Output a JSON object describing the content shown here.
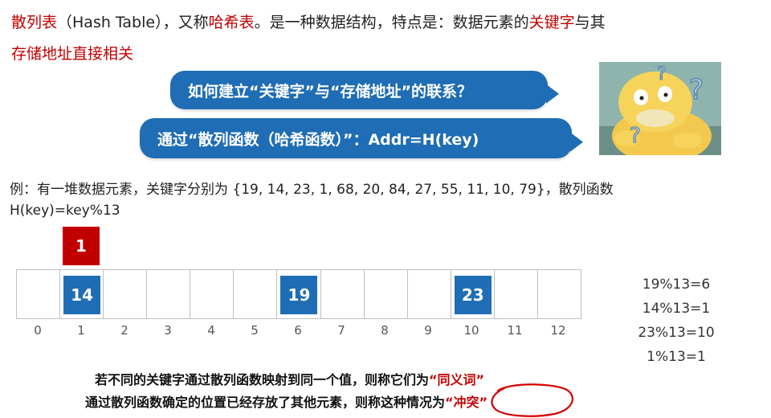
{
  "header": {
    "term": "散列表",
    "term_en": "（Hash Table）",
    "alias_prefix": "，又称",
    "alias": "哈希表",
    "desc1": "。是一种数据结构，特点是：数据元素的",
    "key_word": "关键字",
    "desc2": "与其",
    "line2": "存储地址直接相关"
  },
  "bubbles": {
    "q1": "如何建立“关键字”与“存储地址”的联系？",
    "q2": "通过“散列函数（哈希函数）”：Addr=H(key)"
  },
  "example": {
    "line1": "例：有一堆数据元素，关键字分别为 {19, 14, 23, 1, 68, 20, 84, 27, 55, 11, 10, 79}，散列函数",
    "line2": "H(key)=key%13"
  },
  "table": {
    "indices": [
      "0",
      "1",
      "2",
      "3",
      "4",
      "5",
      "6",
      "7",
      "8",
      "9",
      "10",
      "11",
      "12"
    ],
    "filled": [
      {
        "slot": 1,
        "value": "14"
      },
      {
        "slot": 6,
        "value": "19"
      },
      {
        "slot": 10,
        "value": "23"
      }
    ],
    "conflict_value": "1",
    "conflict_color": "#c00000",
    "cell_color": "#1f6db4"
  },
  "calculations": [
    "19%13=6",
    "14%13=1",
    "23%13=10",
    "1%13=1"
  ],
  "notes": {
    "n1_prefix": "若不同的关键字通过散列函数映射到同一个值，则称它们为",
    "n1_hl": "“同义词”",
    "n2_prefix": "通过散列函数确定的位置已经存放了其他元素，则称这种情况为",
    "n2_hl": "“冲突”"
  },
  "meme": {
    "icon": "psyduck-confused-icon"
  }
}
